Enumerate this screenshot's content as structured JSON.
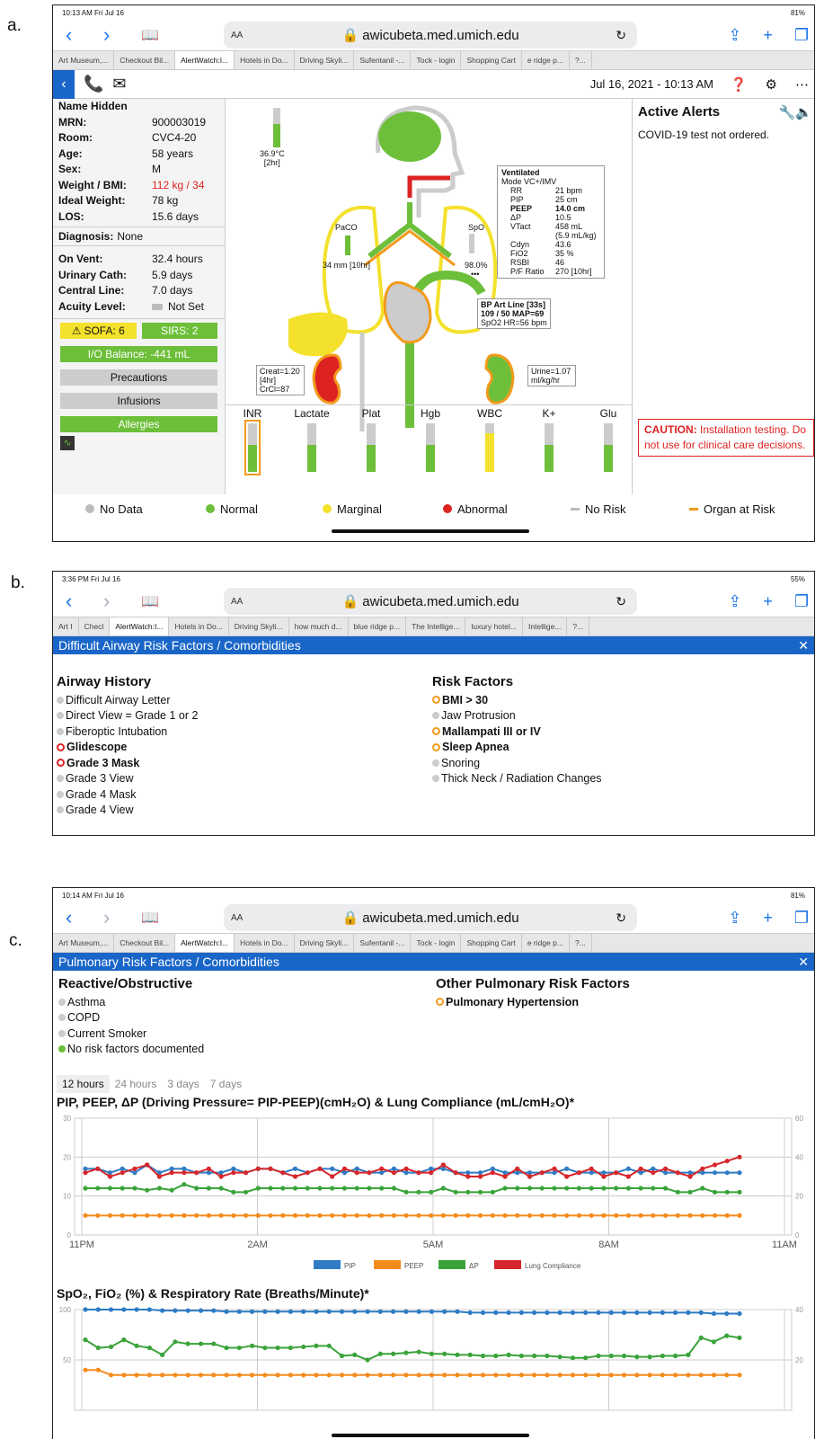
{
  "labels": {
    "a": "a.",
    "b": "b.",
    "c": "c."
  },
  "a": {
    "status_time": "10:13 AM  Fri Jul 16",
    "status_batt": "81%",
    "url": "awicubeta.med.umich.edu",
    "tabs": [
      "Art Museum,...",
      "Checkout Bil...",
      "AlertWatch:I...",
      "Hotels in Do...",
      "Driving Skyli...",
      "Sufentanil -...",
      "Tock - login",
      "Shopping Cart",
      "e ridge p...",
      "?..."
    ],
    "datetime": "Jul 16, 2021 - 10:13 AM",
    "patient": [
      {
        "k": "Name Hidden",
        "v": ""
      },
      {
        "k": "MRN:",
        "v": "900003019"
      },
      {
        "k": "Room:",
        "v": "CVC4-20"
      },
      {
        "k": "Age:",
        "v": "58 years"
      },
      {
        "k": "Sex:",
        "v": "M"
      },
      {
        "k": "Weight / BMI:",
        "v": "112 kg / 34"
      },
      {
        "k": "Ideal Weight:",
        "v": "78 kg"
      },
      {
        "k": "LOS:",
        "v": "15.6 days"
      },
      {
        "k": "Diagnosis:",
        "v": "None"
      },
      {
        "k": "On Vent:",
        "v": "32.4 hours"
      },
      {
        "k": "Urinary Cath:",
        "v": "5.9 days"
      },
      {
        "k": "Central Line:",
        "v": "7.0 days"
      },
      {
        "k": "Acuity Level:",
        "v": "Not Set"
      }
    ],
    "sofa": "SOFA: 6",
    "sirs": "SIRS: 2",
    "io": "I/O Balance: -441 mL",
    "precautions": "Precautions",
    "infusions": "Infusions",
    "allergies": "Allergies",
    "temp": "36.9°C",
    "temp_time": "[2hr]",
    "paco2": "PaCO",
    "paco2_val": "34 mm [10hr]",
    "spo2": "SpO",
    "spo2_val": "98.0%",
    "spo2_dots": "•••",
    "vent_title": "Ventilated",
    "vent_mode": "Mode VC+/IMV",
    "vent": [
      [
        "RR",
        "21 bpm"
      ],
      [
        "PIP",
        "25 cm"
      ],
      [
        "PEEP",
        "14.0 cm"
      ],
      [
        "ΔP",
        "10.5"
      ],
      [
        "VTact",
        "458 mL"
      ],
      [
        "",
        "(5.9 mL/kg)"
      ],
      [
        "Cdyn",
        "43.6"
      ],
      [
        "FiO2",
        "35 %"
      ],
      [
        "RSBI",
        "46"
      ],
      [
        "P/F Ratio",
        "270 [10hr]"
      ]
    ],
    "bp1": "BP Art Line [33s]",
    "bp2": "109 / 50 MAP=69",
    "bp3": "SpO2 HR=56 bpm",
    "creat": [
      "Creat=1.20",
      "[4hr]",
      "CrCl=87"
    ],
    "urine": [
      "Urine=1.07",
      "ml/kg/hr"
    ],
    "labs": [
      "INR",
      "Lactate",
      "Plat",
      "Hgb",
      "WBC",
      "K+",
      "Glu"
    ],
    "alerts_title": "Active Alerts",
    "alert1": "COVID-19 test not ordered.",
    "caution_b": "CAUTION:",
    "caution": " Installation testing. Do not use for clinical care decisions.",
    "legend": [
      "No Data",
      "Normal",
      "Marginal",
      "Abnormal",
      "No Risk",
      "Organ at Risk"
    ]
  },
  "b": {
    "status_time": "3:36 PM  Fri Jul 16",
    "status_batt": "55%",
    "url": "awicubeta.med.umich.edu",
    "tabs": [
      "Art I",
      "Checl",
      "AlertWatch:I...",
      "Hotels in Do...",
      "Driving Skyli...",
      "how much d...",
      "blue ridge p...",
      "The Intellige...",
      "luxury hotel...",
      "Intellige...",
      "?..."
    ],
    "bar": "Difficult Airway Risk Factors / Comorbidities",
    "h1": "Airway History",
    "hist": [
      {
        "t": "Difficult Airway Letter",
        "s": "n"
      },
      {
        "t": "Direct View = Grade 1 or 2",
        "s": "n"
      },
      {
        "t": "Fiberoptic Intubation",
        "s": "n"
      },
      {
        "t": "Glidescope",
        "s": "r"
      },
      {
        "t": "Grade 3 Mask",
        "s": "r"
      },
      {
        "t": "Grade 3 View",
        "s": "n"
      },
      {
        "t": "Grade 4 Mask",
        "s": "n"
      },
      {
        "t": "Grade 4 View",
        "s": "n"
      }
    ],
    "h2": "Risk Factors",
    "risk": [
      {
        "t": "BMI > 30",
        "s": "o"
      },
      {
        "t": "Jaw Protrusion",
        "s": "n"
      },
      {
        "t": "Mallampati III or IV",
        "s": "o"
      },
      {
        "t": "Sleep Apnea",
        "s": "o"
      },
      {
        "t": "Snoring",
        "s": "n"
      },
      {
        "t": "Thick Neck / Radiation Changes",
        "s": "n"
      }
    ]
  },
  "c": {
    "status_time": "10:14 AM  Fri Jul 16",
    "status_batt": "81%",
    "url": "awicubeta.med.umich.edu",
    "tabs": [
      "Art Museum,...",
      "Checkout Bil...",
      "AlertWatch:I...",
      "Hotels in Do...",
      "Driving Skyli...",
      "Sufentanil -...",
      "Tock - login",
      "Shopping Cart",
      "e ridge p...",
      "?..."
    ],
    "bar": "Pulmonary Risk Factors / Comorbidities",
    "h1": "Reactive/Obstructive",
    "react": [
      {
        "t": "Asthma",
        "s": "n"
      },
      {
        "t": "COPD",
        "s": "n"
      },
      {
        "t": "Current Smoker",
        "s": "n"
      },
      {
        "t": "No risk factors documented",
        "s": "g"
      }
    ],
    "h2": "Other Pulmonary Risk Factors",
    "other": [
      {
        "t": "Pulmonary Hypertension",
        "s": "o"
      }
    ],
    "ranges": [
      "12 hours",
      "24 hours",
      "3 days",
      "7 days"
    ],
    "chart1_title": "PIP, PEEP, ΔP (Driving Pressure= PIP-PEEP)(cmH₂O) & Lung Compliance (mL/cmH₂O)*",
    "chart2_title": "SpO₂, FiO₂ (%) & Respiratory Rate (Breaths/Minute)*"
  },
  "chart_data": [
    {
      "type": "line",
      "title": "PIP, PEEP, ΔP (Driving Pressure= PIP-PEEP)(cmH₂O) & Lung Compliance (mL/cmH₂O)*",
      "categories": [
        "11PM",
        "2AM",
        "5AM",
        "8AM",
        "11AM"
      ],
      "ylim": [
        0,
        30
      ],
      "y2lim": [
        0,
        60
      ],
      "yticks": [
        0,
        10,
        20,
        30
      ],
      "y2ticks": [
        0,
        20,
        40,
        60
      ],
      "series": [
        {
          "name": "PIP",
          "color": "#2f7bc4",
          "values": [
            17,
            17,
            16,
            17,
            16,
            18,
            16,
            17,
            17,
            16,
            16,
            16,
            17,
            16,
            17,
            17,
            16,
            17,
            16,
            17,
            17,
            16,
            17,
            16,
            16,
            17,
            16,
            16,
            17,
            17,
            16,
            16,
            16,
            17,
            16,
            16,
            16,
            16,
            16,
            17,
            16,
            16,
            16,
            16,
            17,
            16,
            17,
            16,
            16,
            16,
            16,
            16,
            16,
            16
          ]
        },
        {
          "name": "PEEP",
          "color": "#f48b1c",
          "values": [
            5,
            5,
            5,
            5,
            5,
            5,
            5,
            5,
            5,
            5,
            5,
            5,
            5,
            5,
            5,
            5,
            5,
            5,
            5,
            5,
            5,
            5,
            5,
            5,
            5,
            5,
            5,
            5,
            5,
            5,
            5,
            5,
            5,
            5,
            5,
            5,
            5,
            5,
            5,
            5,
            5,
            5,
            5,
            5,
            5,
            5,
            5,
            5,
            5,
            5,
            5,
            5,
            5,
            5
          ]
        },
        {
          "name": "ΔP",
          "color": "#3aa33a",
          "values": [
            12,
            12,
            12,
            12,
            12,
            11.5,
            12,
            11.5,
            13,
            12,
            12,
            12,
            11,
            11,
            12,
            12,
            12,
            12,
            12,
            12,
            12,
            12,
            12,
            12,
            12,
            12,
            11,
            11,
            11,
            12,
            11,
            11,
            11,
            11,
            12,
            12,
            12,
            12,
            12,
            12,
            12,
            12,
            12,
            12,
            12,
            12,
            12,
            12,
            11,
            11,
            12,
            11,
            11,
            11
          ]
        },
        {
          "name": "Lung Compliance",
          "color": "#d6262b",
          "values": [
            16,
            17,
            15,
            16,
            17,
            18,
            15,
            16,
            16,
            16,
            17,
            15,
            16,
            16,
            17,
            17,
            16,
            15,
            16,
            17,
            15,
            17,
            16,
            16,
            17,
            16,
            17,
            16,
            16,
            18,
            16,
            15,
            15,
            16,
            15,
            17,
            15,
            16,
            17,
            15,
            16,
            17,
            15,
            16,
            15,
            17,
            16,
            17,
            16,
            15,
            17,
            18,
            19,
            20
          ]
        }
      ]
    },
    {
      "type": "line",
      "title": "SpO₂, FiO₂ (%) & Respiratory Rate (Breaths/Minute)*",
      "categories": [
        "11PM",
        "2AM",
        "5AM",
        "8AM",
        "11AM"
      ],
      "ylim": [
        0,
        100
      ],
      "yticks": [
        50,
        100
      ],
      "y2ticks": [
        20,
        40
      ],
      "series": [
        {
          "name": "SpO2",
          "color": "#2f7bc4",
          "values": [
            100,
            100,
            100,
            100,
            100,
            100,
            99,
            99,
            99,
            99,
            99,
            98,
            98,
            98,
            98,
            98,
            98,
            98,
            98,
            98,
            98,
            98,
            98,
            98,
            98,
            98,
            98,
            98,
            98,
            98,
            97,
            97,
            97,
            97,
            97,
            97,
            97,
            97,
            97,
            97,
            97,
            97,
            97,
            97,
            97,
            97,
            97,
            97,
            97,
            96,
            96,
            96
          ]
        },
        {
          "name": "FiO2",
          "color": "#f48b1c",
          "values": [
            40,
            40,
            35,
            35,
            35,
            35,
            35,
            35,
            35,
            35,
            35,
            35,
            35,
            35,
            35,
            35,
            35,
            35,
            35,
            35,
            35,
            35,
            35,
            35,
            35,
            35,
            35,
            35,
            35,
            35,
            35,
            35,
            35,
            35,
            35,
            35,
            35,
            35,
            35,
            35,
            35,
            35,
            35,
            35,
            35,
            35,
            35,
            35,
            35,
            35,
            35,
            35
          ]
        },
        {
          "name": "RR",
          "color": "#3aa33a",
          "values": [
            70,
            62,
            63,
            70,
            64,
            62,
            55,
            68,
            66,
            66,
            66,
            62,
            62,
            64,
            62,
            62,
            62,
            63,
            64,
            64,
            54,
            55,
            50,
            56,
            56,
            57,
            58,
            56,
            56,
            55,
            55,
            54,
            54,
            55,
            54,
            54,
            54,
            53,
            52,
            52,
            54,
            54,
            54,
            53,
            53,
            54,
            54,
            55,
            72,
            68,
            74,
            72
          ]
        }
      ]
    }
  ]
}
